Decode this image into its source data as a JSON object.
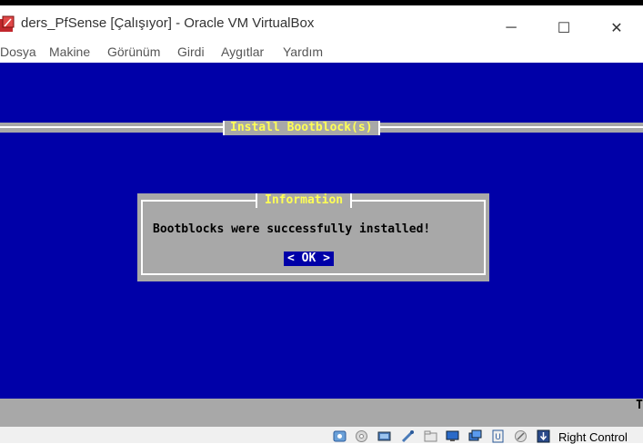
{
  "window": {
    "title": "ders_PfSense [Çalışıyor] - Oracle VM VirtualBox",
    "minimize_glyph": "─",
    "maximize_glyph": "☐",
    "close_glyph": "✕"
  },
  "menubar": {
    "items": [
      "Dosya",
      "Makine",
      "Görünüm",
      "Girdi",
      "Aygıtlar",
      "Yardım"
    ]
  },
  "vm": {
    "header_title": "Install Bootblock(s)",
    "dialog": {
      "title": "Information",
      "message": "Bootblocks were successfully installed!",
      "ok_label": "< OK >"
    },
    "bottom_bar_char": "T"
  },
  "statusbar": {
    "icons": [
      "hard-disk-icon",
      "optical-drive-icon",
      "audio-icon",
      "network-icon",
      "usb-icon",
      "shared-folders-icon",
      "display-icon",
      "video-capture-icon",
      "cpu-icon",
      "mouse-integration-icon",
      "keyboard-icon"
    ],
    "host_key": "Right Control"
  },
  "colors": {
    "vm_background": "#0000a8",
    "dialog_gray": "#a8a8a8",
    "title_yellow": "#ffff55",
    "button_blue": "#0000a8"
  }
}
